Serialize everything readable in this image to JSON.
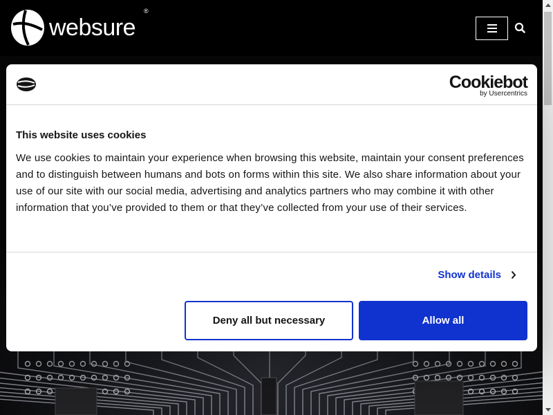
{
  "header": {
    "logo_text": "websure",
    "logo_registered": "®",
    "menu_icon": "hamburger-icon",
    "search_icon": "search-icon"
  },
  "cookie_dialog": {
    "brand_name": "Cookiebot",
    "brand_sub": "by Usercentrics",
    "title": "This website uses cookies",
    "body": "We use cookies to maintain your experience when browsing this website, maintain your consent preferences and to distinguish between humans and bots on forms within this site. We also share information about your use of our site with our social media, advertising and analytics partners who may combine it with other information that you’ve provided to them or that they’ve collected from your use of their services.",
    "show_details_label": "Show details",
    "deny_label": "Deny all but necessary",
    "allow_label": "Allow all"
  },
  "colors": {
    "accent": "#1032cf",
    "header_bg": "#000000",
    "dialog_bg": "#ffffff",
    "text": "#141414"
  }
}
